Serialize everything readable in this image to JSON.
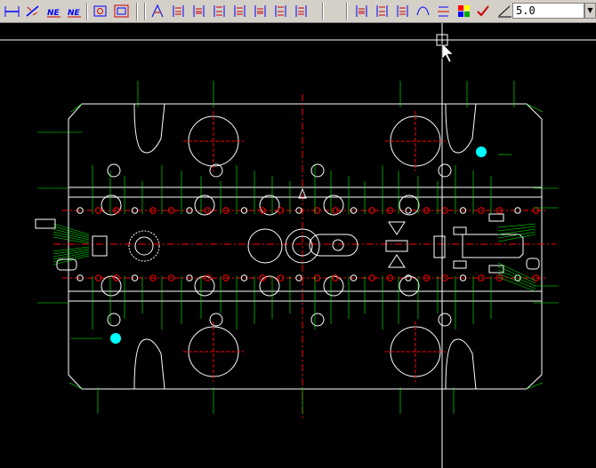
{
  "toolbar": {
    "buttons": [
      {
        "name": "dimension-horizontal-icon"
      },
      {
        "name": "dimension-aligned-icon"
      },
      {
        "name": "dimension-ne-icon",
        "label": "NE"
      },
      {
        "name": "dimension-ne-offset-icon",
        "label": "NE"
      },
      {
        "name": "dimension-box-icon"
      },
      {
        "name": "dimension-frame-icon"
      },
      {
        "name": "text-edit-icon"
      },
      {
        "name": "dimension-vertical-group-icon"
      },
      {
        "name": "dimension-stack-icon"
      },
      {
        "name": "dimension-stack-alt-icon"
      },
      {
        "name": "dimension-arrows-icon"
      },
      {
        "name": "dimension-bracket-icon"
      },
      {
        "name": "dimension-extend-icon"
      },
      {
        "name": "dimension-flip-icon"
      },
      {
        "name": "chain-icon"
      },
      {
        "name": "list-icon"
      },
      {
        "name": "dimension-column-icon"
      },
      {
        "name": "curve-icon"
      },
      {
        "name": "text-style-icon"
      },
      {
        "name": "palette-icon"
      },
      {
        "name": "checkmark-pen-icon"
      },
      {
        "name": "text-angle-icon"
      }
    ],
    "zoom_value": "5.0"
  },
  "colors": {
    "background": "#000000",
    "geometry": "#ffffff",
    "centerline": "#ff0000",
    "dimension": "#00ff00",
    "holes": "#ff0000",
    "marker": "#00ffff"
  }
}
